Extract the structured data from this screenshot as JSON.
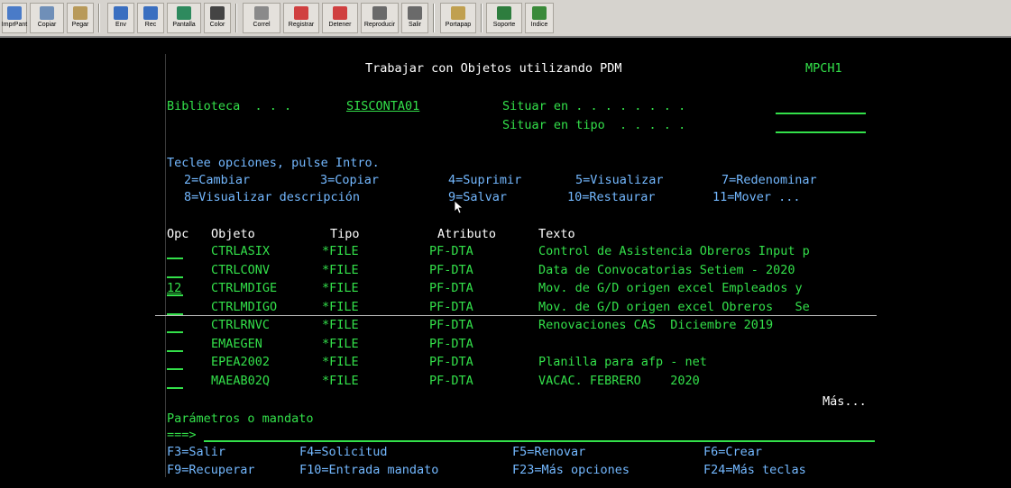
{
  "toolbar": [
    {
      "label": "ImprPant",
      "icon": "print-screen-icon",
      "color": "#4a7bc8"
    },
    {
      "label": "Copiar",
      "icon": "copy-icon",
      "color": "#6f8fb8"
    },
    {
      "label": "Pegar",
      "icon": "paste-icon",
      "color": "#b89a5a"
    },
    {
      "label": "Env",
      "icon": "send-icon",
      "color": "#3a6fc0"
    },
    {
      "label": "Rec",
      "icon": "receive-icon",
      "color": "#3a6fc0"
    },
    {
      "label": "Pantalla",
      "icon": "display-icon",
      "color": "#2e8a5e"
    },
    {
      "label": "Color",
      "icon": "color-icon",
      "color": "#444444"
    },
    {
      "label": "Correl",
      "icon": "macro-icon",
      "color": "#8a8a8a"
    },
    {
      "label": "Registrar",
      "icon": "record-icon",
      "color": "#d04040"
    },
    {
      "label": "Detener",
      "icon": "stop-icon",
      "color": "#d04040"
    },
    {
      "label": "Reproducir",
      "icon": "play-icon",
      "color": "#6a6a6a"
    },
    {
      "label": "Salir",
      "icon": "exit-icon",
      "color": "#6a6a6a"
    },
    {
      "label": "Portapap",
      "icon": "clipboard-icon",
      "color": "#c0a050"
    },
    {
      "label": "Soporte",
      "icon": "globe-icon",
      "color": "#2e7d3e"
    },
    {
      "label": "Indice",
      "icon": "index-icon",
      "color": "#3a8a3a"
    }
  ],
  "screen": {
    "title": "Trabajar con Objetos utilizando PDM",
    "system": "MPCH1",
    "lib_label": "Biblioteca  . . .",
    "lib_value": "SISCONTA01",
    "pos_label": "Situar en . . . . . . . .",
    "pos_type_label": "Situar en tipo  . . . . .",
    "instr": "Teclee opciones, pulse Intro.",
    "opts1": [
      "2=Cambiar",
      "3=Copiar",
      "4=Suprimir",
      "5=Visualizar",
      "7=Redenominar"
    ],
    "opts2": [
      "8=Visualizar descripción",
      "9=Salvar",
      "10=Restaurar",
      "11=Mover ..."
    ],
    "headers": {
      "opc": "Opc",
      "obj": "Objeto",
      "tipo": "Tipo",
      "atrib": "Atributo",
      "texto": "Texto"
    },
    "rows": [
      {
        "opc": "",
        "obj": "CTRLASIX",
        "tipo": "*FILE",
        "atrib": "PF-DTA",
        "texto": "Control de Asistencia Obreros Input p"
      },
      {
        "opc": "",
        "obj": "CTRLCONV",
        "tipo": "*FILE",
        "atrib": "PF-DTA",
        "texto": "Data de Convocatorias Setiem - 2020"
      },
      {
        "opc": "12",
        "obj": "CTRLMDIGE",
        "tipo": "*FILE",
        "atrib": "PF-DTA",
        "texto": "Mov. de G/D origen excel Empleados y"
      },
      {
        "opc": "",
        "obj": "CTRLMDIGO",
        "tipo": "*FILE",
        "atrib": "PF-DTA",
        "texto": "Mov. de G/D origen excel Obreros   Se"
      },
      {
        "opc": "",
        "obj": "CTRLRNVC",
        "tipo": "*FILE",
        "atrib": "PF-DTA",
        "texto": "Renovaciones CAS  Diciembre 2019"
      },
      {
        "opc": "",
        "obj": "EMAEGEN",
        "tipo": "*FILE",
        "atrib": "PF-DTA",
        "texto": ""
      },
      {
        "opc": "",
        "obj": "EPEA2002",
        "tipo": "*FILE",
        "atrib": "PF-DTA",
        "texto": "Planilla para afp - net"
      },
      {
        "opc": "",
        "obj": "MAEAB02Q",
        "tipo": "*FILE",
        "atrib": "PF-DTA",
        "texto": "VACAC. FEBRERO    2020"
      }
    ],
    "more": "Más...",
    "params_label": "Parámetros o mandato",
    "prompt": "===>",
    "fkeys1": [
      "F3=Salir",
      "F4=Solicitud",
      "F5=Renovar",
      "F6=Crear"
    ],
    "fkeys2": [
      "F9=Recuperar",
      "F10=Entrada mandato",
      "F23=Más opciones",
      "F24=Más teclas"
    ]
  }
}
